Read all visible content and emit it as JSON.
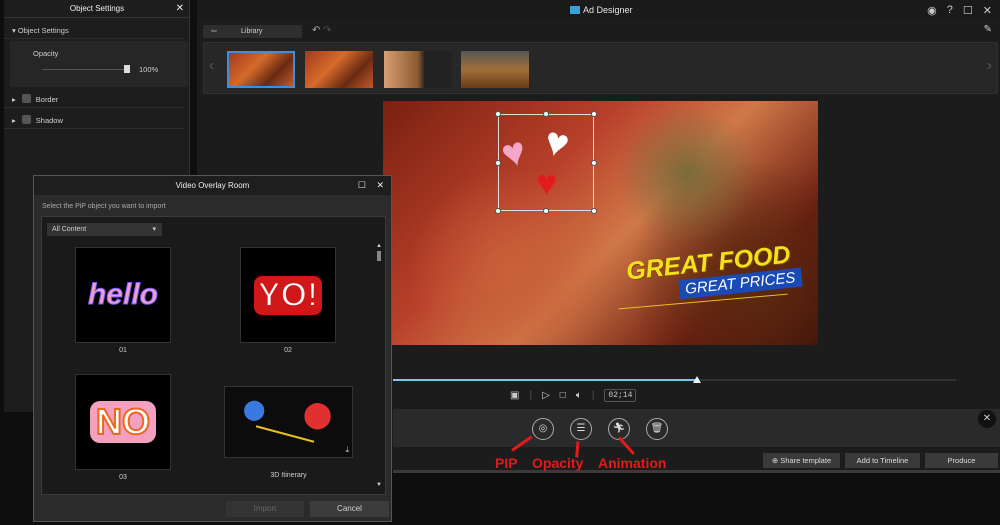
{
  "app": {
    "title": "Ad Designer",
    "window_icons": [
      "account-icon",
      "help-icon",
      "maximize-icon",
      "close-icon"
    ]
  },
  "toolbar": {
    "library_label": "Library"
  },
  "object_settings": {
    "title": "Object Settings",
    "section": "Object Settings",
    "opacity_label": "Opacity",
    "opacity_value": "100%",
    "opacity_fraction": 1.0,
    "border_label": "Border",
    "shadow_label": "Shadow"
  },
  "preview": {
    "headline": "GREAT FOOD",
    "subline": "GREAT PRICES"
  },
  "player": {
    "time": "02;14",
    "progress": 0.54
  },
  "actions": {
    "share": "Share template",
    "add": "Add to Timeline",
    "produce": "Produce"
  },
  "annotations": {
    "pip": "PIP",
    "opacity": "Opacity",
    "animation": "Animation"
  },
  "dialog": {
    "title": "Video Overlay Room",
    "instruction": "Select the PiP object you want to import",
    "filter": "All Content",
    "items": [
      {
        "label": "01",
        "art": "hello"
      },
      {
        "label": "02",
        "art": "YO!"
      },
      {
        "label": "03",
        "art": "NO"
      },
      {
        "label": "3D Itinerary",
        "art": ""
      }
    ],
    "import": "Import",
    "cancel": "Cancel"
  }
}
